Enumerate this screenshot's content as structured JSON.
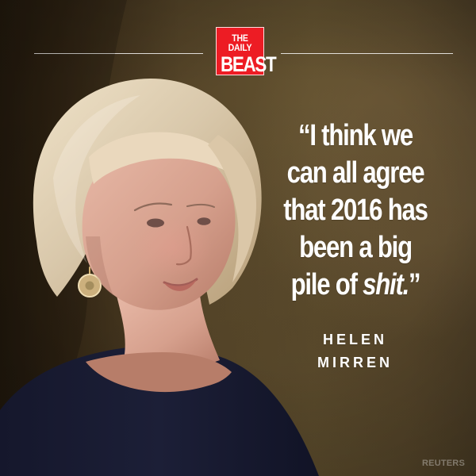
{
  "brand": {
    "line1": "THE DAILY",
    "line2": "BEAST",
    "primary_color": "#ed1c24"
  },
  "quote": {
    "lines": [
      "“I think we",
      "can all agree",
      "that 2016 has",
      "been a big"
    ],
    "last_line_prefix": "pile of ",
    "last_line_emphasis": "shit.",
    "last_line_suffix": "”"
  },
  "attribution": {
    "line1": "HELEN",
    "line2": "MIRREN"
  },
  "photo_credit": "REUTERS",
  "colors": {
    "text": "#ffffff",
    "background_dark": "#2d2111",
    "background_mid": "#62512f",
    "hair": "#d9c8ab",
    "dress": "#1b1c33",
    "skin": "#d6a08d"
  }
}
